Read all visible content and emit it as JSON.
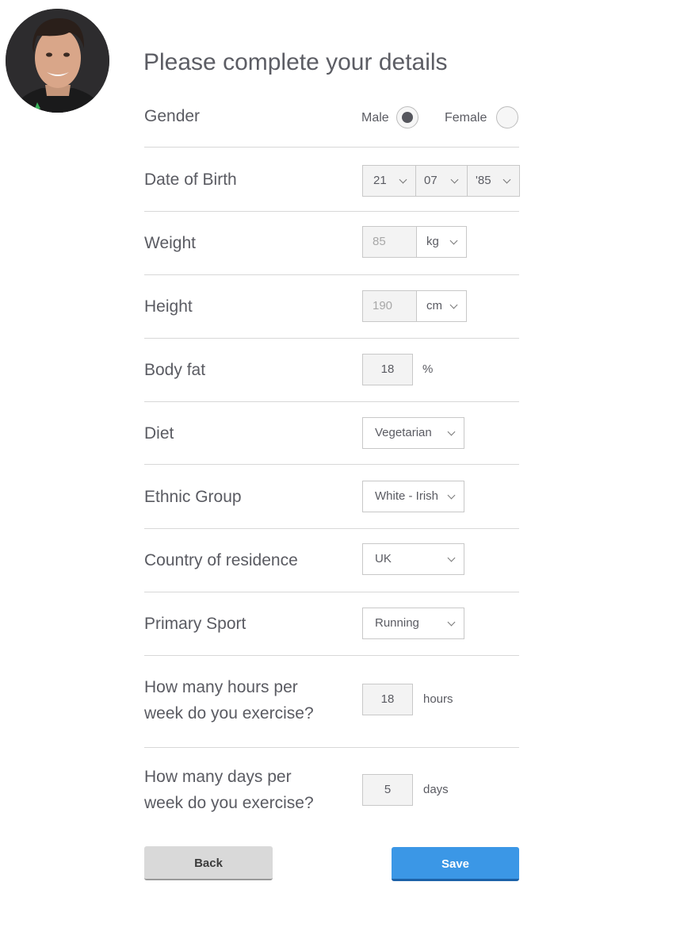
{
  "header": {
    "title": "Please complete your details"
  },
  "profile": {
    "avatar_icon": "user-photo"
  },
  "form": {
    "gender": {
      "label": "Gender",
      "male": "Male",
      "female": "Female",
      "selected": "Male"
    },
    "dob": {
      "label": "Date of Birth",
      "day": "21",
      "month": "07",
      "year": "'85"
    },
    "weight": {
      "label": "Weight",
      "value": "85",
      "unit": "kg"
    },
    "height": {
      "label": "Height",
      "value": "190",
      "unit": "cm"
    },
    "body_fat": {
      "label": "Body fat",
      "value": "18",
      "unit": "%"
    },
    "diet": {
      "label": "Diet",
      "value": "Vegetarian"
    },
    "ethnic_group": {
      "label": "Ethnic Group",
      "value": "White - Irish"
    },
    "country": {
      "label": "Country of residence",
      "value": "UK"
    },
    "primary_sport": {
      "label": "Primary Sport",
      "value": "Running"
    },
    "hours": {
      "label_line1": "How many hours per",
      "label_line2": "week do you exercise?",
      "value": "18",
      "unit": "hours"
    },
    "days": {
      "label_line1": "How many days per",
      "label_line2": "week do you exercise?",
      "value": "5",
      "unit": "days"
    }
  },
  "actions": {
    "back": "Back",
    "save": "Save"
  },
  "colors": {
    "accent": "#3b97e6",
    "text": "#5a5b62",
    "divider": "#d8d8d8"
  }
}
